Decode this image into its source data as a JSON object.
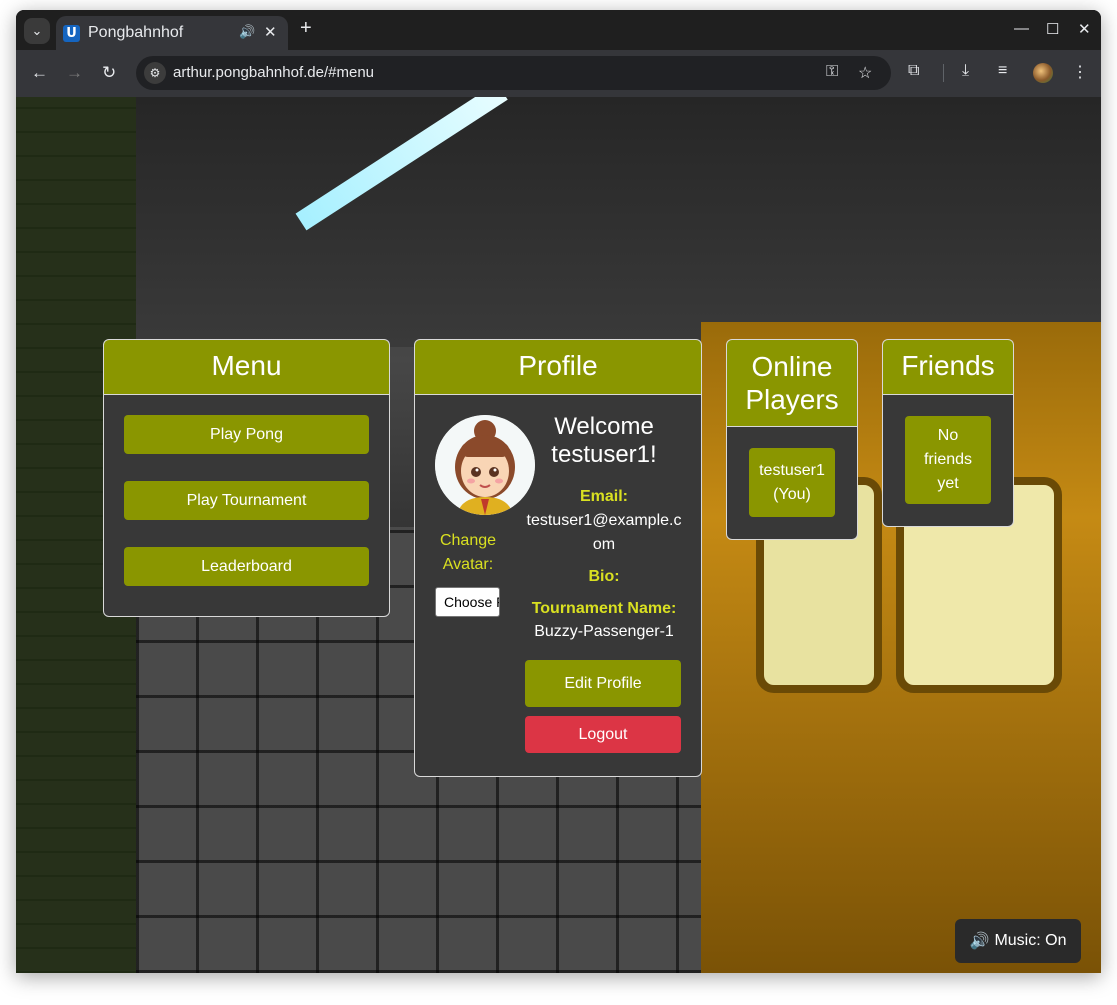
{
  "browser": {
    "tab_title": "Pongbahnhof",
    "favicon_letter": "U",
    "url": "arthur.pongbahnhof.de/#menu",
    "new_tab_symbol": "+",
    "minimize_symbol": "—",
    "maximize_symbol": "☐",
    "close_symbol": "✕"
  },
  "menu_panel": {
    "title": "Menu",
    "buttons": [
      "Play Pong",
      "Play Tournament",
      "Leaderboard"
    ]
  },
  "profile_panel": {
    "title": "Profile",
    "welcome": "Welcome testuser1!",
    "change_avatar_label": "Change Avatar:",
    "file_button_label": "Choose File",
    "email_label": "Email:",
    "email_value": "testuser1@example.com",
    "bio_label": "Bio:",
    "tournament_name_label": "Tournament Name:",
    "tournament_name_value": "Buzzy-Passenger-1",
    "edit_button": "Edit Profile",
    "logout_button": "Logout"
  },
  "online_panel": {
    "title": "Online Players",
    "players": [
      "testuser1 (You)"
    ]
  },
  "friends_panel": {
    "title": "Friends",
    "empty_text": "No friends yet"
  },
  "music_toggle": {
    "icon": "🔊",
    "label": "Music: On"
  },
  "colors": {
    "accent_olive": "#8a9600",
    "label_yellow": "#d9e021",
    "logout_red": "#dc3545",
    "panel_body": "#383838"
  }
}
